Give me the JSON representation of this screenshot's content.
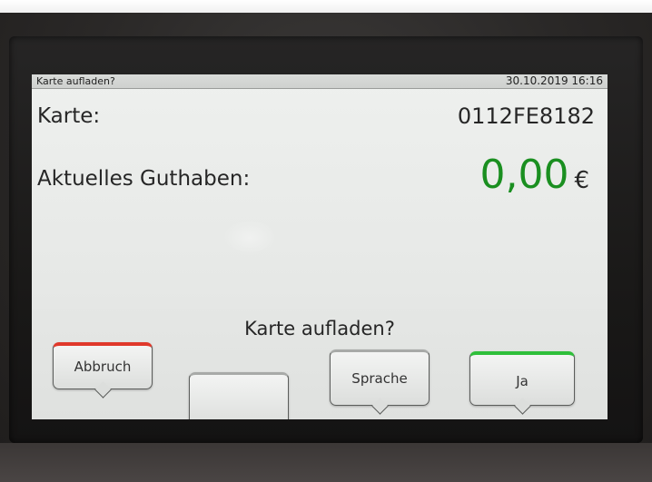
{
  "status_bar": {
    "title": "Karte aufladen?",
    "datetime": "30.10.2019 16:16"
  },
  "card": {
    "label": "Karte:",
    "number": "0112FE8182"
  },
  "balance": {
    "label": "Aktuelles Guthaben:",
    "amount": "0,00",
    "currency": "€"
  },
  "prompt": {
    "question": "Karte aufladen?"
  },
  "softkeys": [
    {
      "label": "Abbruch",
      "accent": "#e0392b"
    },
    {
      "label": "",
      "accent": "#a8aaa8"
    },
    {
      "label": "Sprache",
      "accent": "#a8aaa8"
    },
    {
      "label": "Ja",
      "accent": "#2fbf3a"
    }
  ],
  "colors": {
    "amount": "#1a8f20",
    "screen_bg": "#e8eae8"
  }
}
